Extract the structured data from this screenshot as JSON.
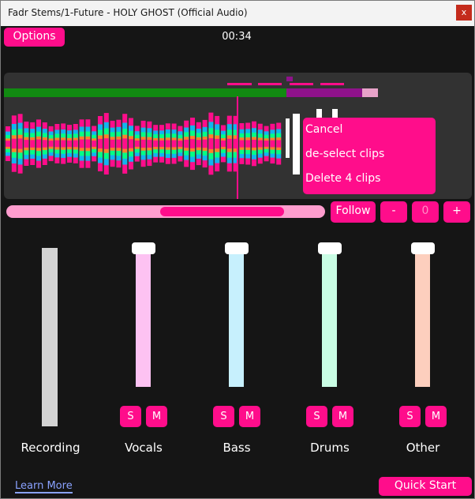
{
  "window": {
    "title": "Fadr Stems/1-Future - HOLY GHOST (Official Audio)",
    "close_label": "x"
  },
  "toolbar": {
    "options_label": "Options",
    "time": "00:34"
  },
  "context_menu": {
    "items": [
      "Cancel",
      "de-select clips",
      "Delete 4 clips"
    ]
  },
  "transport": {
    "follow_label": "Follow",
    "minus_label": "-",
    "zoom_value": "0",
    "plus_label": "+"
  },
  "channels": [
    {
      "name": "Recording",
      "color": "#d3d3d3"
    },
    {
      "name": "Vocals",
      "color": "#fdc2f2",
      "solo": "S",
      "mute": "M"
    },
    {
      "name": "Bass",
      "color": "#c7f0fd",
      "solo": "S",
      "mute": "M"
    },
    {
      "name": "Drums",
      "color": "#c9fde4",
      "solo": "S",
      "mute": "M"
    },
    {
      "name": "Other",
      "color": "#fdcfbe",
      "solo": "S",
      "mute": "M"
    }
  ],
  "footer": {
    "learn_more": "Learn More",
    "quick_start": "Quick Start"
  },
  "colors": {
    "accent": "#ff0d8b",
    "background": "#151515",
    "timeline_bg": "#323232",
    "cyan": "#10b5ef",
    "green": "#04ff85",
    "orange": "#ff7f2a"
  }
}
